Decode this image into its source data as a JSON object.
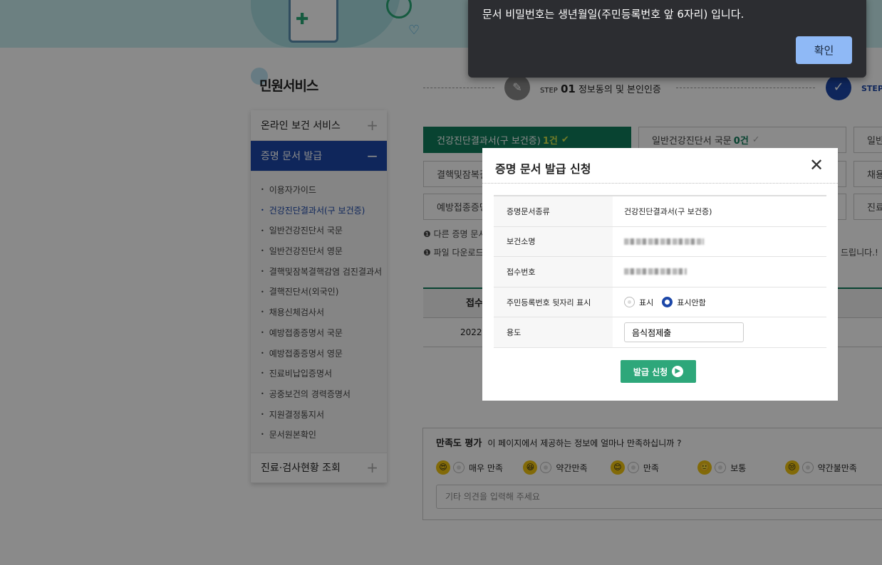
{
  "toast": {
    "message": "문서 비밀번호는 생년월일(주민등록번호 앞 6자리) 입니다.",
    "ok_label": "확인"
  },
  "sidebar": {
    "title": "민원서비스",
    "sections": [
      {
        "label": "온라인 보건 서비스",
        "toggle": "+"
      },
      {
        "label": "증명 문서 발급",
        "toggle": "−"
      },
      {
        "label": "진료·검사현황 조회",
        "toggle": "+"
      }
    ],
    "items": [
      "이용자가이드",
      "건강진단결과서(구 보건증)",
      "일반건강진단서 국문",
      "일반건강진단서 영문",
      "결핵및잠복결핵감염 검진결과서",
      "결핵진단서(외국인)",
      "채용신체검사서",
      "예방접종증명서 국문",
      "예방접종증명서 영문",
      "진료비납입증명서",
      "공중보건의 경력증명서",
      "지원결정통지서",
      "문서원본확인"
    ],
    "current_item": 1
  },
  "steps": {
    "step1_prefix": "STEP",
    "step1_num": "01",
    "step1_label": "정보동의 및 본인인증",
    "step2_prefix": "STEP"
  },
  "tabs": [
    {
      "label": "건강진단결과서(구 보건증)",
      "count": "1건",
      "active": true
    },
    {
      "label": "일반건강진단서 국문",
      "count": "0건"
    },
    {
      "label": "일반"
    },
    {
      "label": "결핵및잠복결"
    },
    {
      "label": "채용"
    },
    {
      "label": "예방접종증명"
    },
    {
      "label": "진료"
    }
  ],
  "notices": [
    "다른 증명 문서",
    "파일 다운로드"
  ],
  "notice_tail": "드립니다.!",
  "table": {
    "header": "접수",
    "row": "2022-"
  },
  "satisfaction": {
    "title": "만족도 평가",
    "question": "이 페이지에서 제공하는 정보에 얼마나 만족하십니까 ?",
    "options": [
      "매우 만족",
      "약간만족",
      "만족",
      "보통",
      "약간불만족"
    ],
    "placeholder": "기타 의견을 입력해 주세요"
  },
  "modal": {
    "title": "증명 문서 발급 신청",
    "rows": [
      {
        "label": "증명문서종류",
        "value": "건강진단결과서(구 보건증)"
      },
      {
        "label": "보건소명"
      },
      {
        "label": "접수번호"
      },
      {
        "label": "주민등록번호 뒷자리 표시",
        "options": [
          "표시",
          "표시안함"
        ],
        "selected": "표시안함"
      },
      {
        "label": "용도",
        "value": "음식점제출"
      }
    ],
    "submit_label": "발급 신청"
  },
  "colors": {
    "accent_green": "#0f7c5c",
    "accent_blue": "#1c47a8",
    "toast_button": "#8fb9f6"
  }
}
